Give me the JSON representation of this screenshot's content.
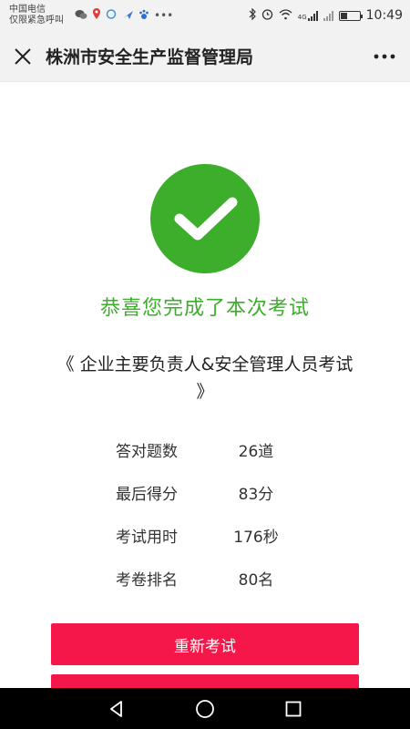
{
  "status_bar": {
    "carrier_line1": "中国电信",
    "carrier_line2": "仅限紧急呼叫",
    "time": "10:49",
    "network": "4G"
  },
  "title_bar": {
    "title": "株洲市安全生产监督管理局"
  },
  "result": {
    "congrats": "恭喜您完成了本次考试",
    "exam_name": "《 企业主要负责人&安全管理人员考试 》"
  },
  "stats": [
    {
      "label": "答对题数",
      "value": "26道"
    },
    {
      "label": "最后得分",
      "value": "83分"
    },
    {
      "label": "考试用时",
      "value": "176秒"
    },
    {
      "label": "考卷排名",
      "value": "80名"
    }
  ],
  "actions": {
    "retake_label": "重新考试"
  },
  "colors": {
    "success_green": "#3dae2b",
    "button_red": "#f5164a"
  }
}
